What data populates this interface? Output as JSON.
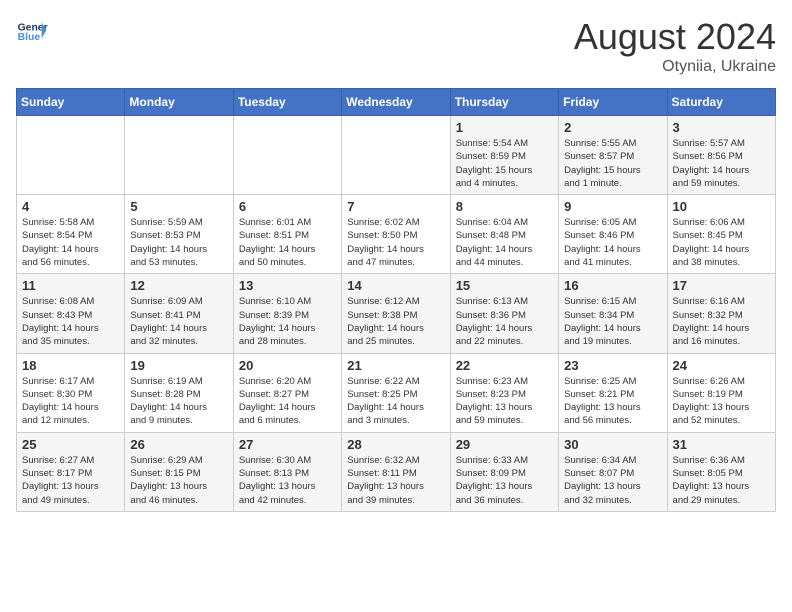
{
  "header": {
    "logo_line1": "General",
    "logo_line2": "Blue",
    "month_year": "August 2024",
    "location": "Otyniia, Ukraine"
  },
  "days_of_week": [
    "Sunday",
    "Monday",
    "Tuesday",
    "Wednesday",
    "Thursday",
    "Friday",
    "Saturday"
  ],
  "weeks": [
    [
      {
        "day": "",
        "info": ""
      },
      {
        "day": "",
        "info": ""
      },
      {
        "day": "",
        "info": ""
      },
      {
        "day": "",
        "info": ""
      },
      {
        "day": "1",
        "info": "Sunrise: 5:54 AM\nSunset: 8:59 PM\nDaylight: 15 hours\nand 4 minutes."
      },
      {
        "day": "2",
        "info": "Sunrise: 5:55 AM\nSunset: 8:57 PM\nDaylight: 15 hours\nand 1 minute."
      },
      {
        "day": "3",
        "info": "Sunrise: 5:57 AM\nSunset: 8:56 PM\nDaylight: 14 hours\nand 59 minutes."
      }
    ],
    [
      {
        "day": "4",
        "info": "Sunrise: 5:58 AM\nSunset: 8:54 PM\nDaylight: 14 hours\nand 56 minutes."
      },
      {
        "day": "5",
        "info": "Sunrise: 5:59 AM\nSunset: 8:53 PM\nDaylight: 14 hours\nand 53 minutes."
      },
      {
        "day": "6",
        "info": "Sunrise: 6:01 AM\nSunset: 8:51 PM\nDaylight: 14 hours\nand 50 minutes."
      },
      {
        "day": "7",
        "info": "Sunrise: 6:02 AM\nSunset: 8:50 PM\nDaylight: 14 hours\nand 47 minutes."
      },
      {
        "day": "8",
        "info": "Sunrise: 6:04 AM\nSunset: 8:48 PM\nDaylight: 14 hours\nand 44 minutes."
      },
      {
        "day": "9",
        "info": "Sunrise: 6:05 AM\nSunset: 8:46 PM\nDaylight: 14 hours\nand 41 minutes."
      },
      {
        "day": "10",
        "info": "Sunrise: 6:06 AM\nSunset: 8:45 PM\nDaylight: 14 hours\nand 38 minutes."
      }
    ],
    [
      {
        "day": "11",
        "info": "Sunrise: 6:08 AM\nSunset: 8:43 PM\nDaylight: 14 hours\nand 35 minutes."
      },
      {
        "day": "12",
        "info": "Sunrise: 6:09 AM\nSunset: 8:41 PM\nDaylight: 14 hours\nand 32 minutes."
      },
      {
        "day": "13",
        "info": "Sunrise: 6:10 AM\nSunset: 8:39 PM\nDaylight: 14 hours\nand 28 minutes."
      },
      {
        "day": "14",
        "info": "Sunrise: 6:12 AM\nSunset: 8:38 PM\nDaylight: 14 hours\nand 25 minutes."
      },
      {
        "day": "15",
        "info": "Sunrise: 6:13 AM\nSunset: 8:36 PM\nDaylight: 14 hours\nand 22 minutes."
      },
      {
        "day": "16",
        "info": "Sunrise: 6:15 AM\nSunset: 8:34 PM\nDaylight: 14 hours\nand 19 minutes."
      },
      {
        "day": "17",
        "info": "Sunrise: 6:16 AM\nSunset: 8:32 PM\nDaylight: 14 hours\nand 16 minutes."
      }
    ],
    [
      {
        "day": "18",
        "info": "Sunrise: 6:17 AM\nSunset: 8:30 PM\nDaylight: 14 hours\nand 12 minutes."
      },
      {
        "day": "19",
        "info": "Sunrise: 6:19 AM\nSunset: 8:28 PM\nDaylight: 14 hours\nand 9 minutes."
      },
      {
        "day": "20",
        "info": "Sunrise: 6:20 AM\nSunset: 8:27 PM\nDaylight: 14 hours\nand 6 minutes."
      },
      {
        "day": "21",
        "info": "Sunrise: 6:22 AM\nSunset: 8:25 PM\nDaylight: 14 hours\nand 3 minutes."
      },
      {
        "day": "22",
        "info": "Sunrise: 6:23 AM\nSunset: 8:23 PM\nDaylight: 13 hours\nand 59 minutes."
      },
      {
        "day": "23",
        "info": "Sunrise: 6:25 AM\nSunset: 8:21 PM\nDaylight: 13 hours\nand 56 minutes."
      },
      {
        "day": "24",
        "info": "Sunrise: 6:26 AM\nSunset: 8:19 PM\nDaylight: 13 hours\nand 52 minutes."
      }
    ],
    [
      {
        "day": "25",
        "info": "Sunrise: 6:27 AM\nSunset: 8:17 PM\nDaylight: 13 hours\nand 49 minutes."
      },
      {
        "day": "26",
        "info": "Sunrise: 6:29 AM\nSunset: 8:15 PM\nDaylight: 13 hours\nand 46 minutes."
      },
      {
        "day": "27",
        "info": "Sunrise: 6:30 AM\nSunset: 8:13 PM\nDaylight: 13 hours\nand 42 minutes."
      },
      {
        "day": "28",
        "info": "Sunrise: 6:32 AM\nSunset: 8:11 PM\nDaylight: 13 hours\nand 39 minutes."
      },
      {
        "day": "29",
        "info": "Sunrise: 6:33 AM\nSunset: 8:09 PM\nDaylight: 13 hours\nand 36 minutes."
      },
      {
        "day": "30",
        "info": "Sunrise: 6:34 AM\nSunset: 8:07 PM\nDaylight: 13 hours\nand 32 minutes."
      },
      {
        "day": "31",
        "info": "Sunrise: 6:36 AM\nSunset: 8:05 PM\nDaylight: 13 hours\nand 29 minutes."
      }
    ]
  ]
}
